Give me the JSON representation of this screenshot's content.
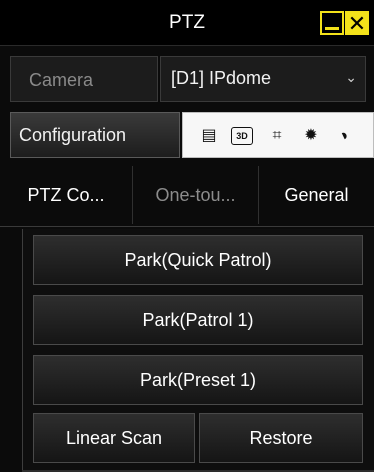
{
  "window": {
    "title": "PTZ",
    "minimize_icon": "minimize-icon",
    "close_icon": "close-icon",
    "accent_color": "#f4e21a"
  },
  "camera": {
    "label": "Camera",
    "selected": "[D1] IPdome",
    "dropdown_icon": "chevron-down-icon"
  },
  "config": {
    "button_label": "Configuration",
    "toolbar_icons": [
      "document-icon",
      "3d-icon",
      "frame-icon",
      "light-icon",
      "wiper-icon"
    ]
  },
  "tabs": [
    {
      "label": "PTZ Co..."
    },
    {
      "label": "One-tou..."
    },
    {
      "label": "General"
    }
  ],
  "actions": {
    "park_quick_patrol": "Park(Quick Patrol)",
    "park_patrol_1": "Park(Patrol 1)",
    "park_preset_1": "Park(Preset 1)",
    "linear_scan": "Linear Scan",
    "restore": "Restore"
  }
}
